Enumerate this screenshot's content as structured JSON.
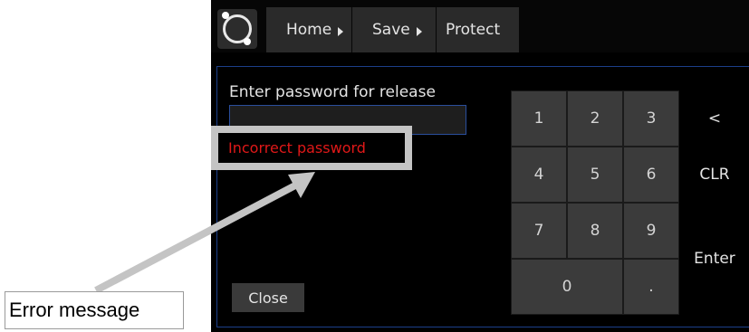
{
  "breadcrumb": {
    "items": [
      "Home",
      "Save",
      "Protect"
    ]
  },
  "dialog": {
    "prompt": "Enter password for release",
    "password_value": "",
    "error_message": "Incorrect password",
    "close_label": "Close"
  },
  "keypad": {
    "k1": "1",
    "k2": "2",
    "k3": "3",
    "k4": "4",
    "k5": "5",
    "k6": "6",
    "k7": "7",
    "k8": "8",
    "k9": "9",
    "k0": "0",
    "kdot": ".",
    "backspace": "<",
    "clear": "CLR",
    "enter": "Enter"
  },
  "annotation": {
    "label": "Error message"
  },
  "colors": {
    "screen_bg": "#000000",
    "panel_border": "#1c3f8a",
    "error_text": "#e01818",
    "callout_gray": "#c4c4c4"
  }
}
